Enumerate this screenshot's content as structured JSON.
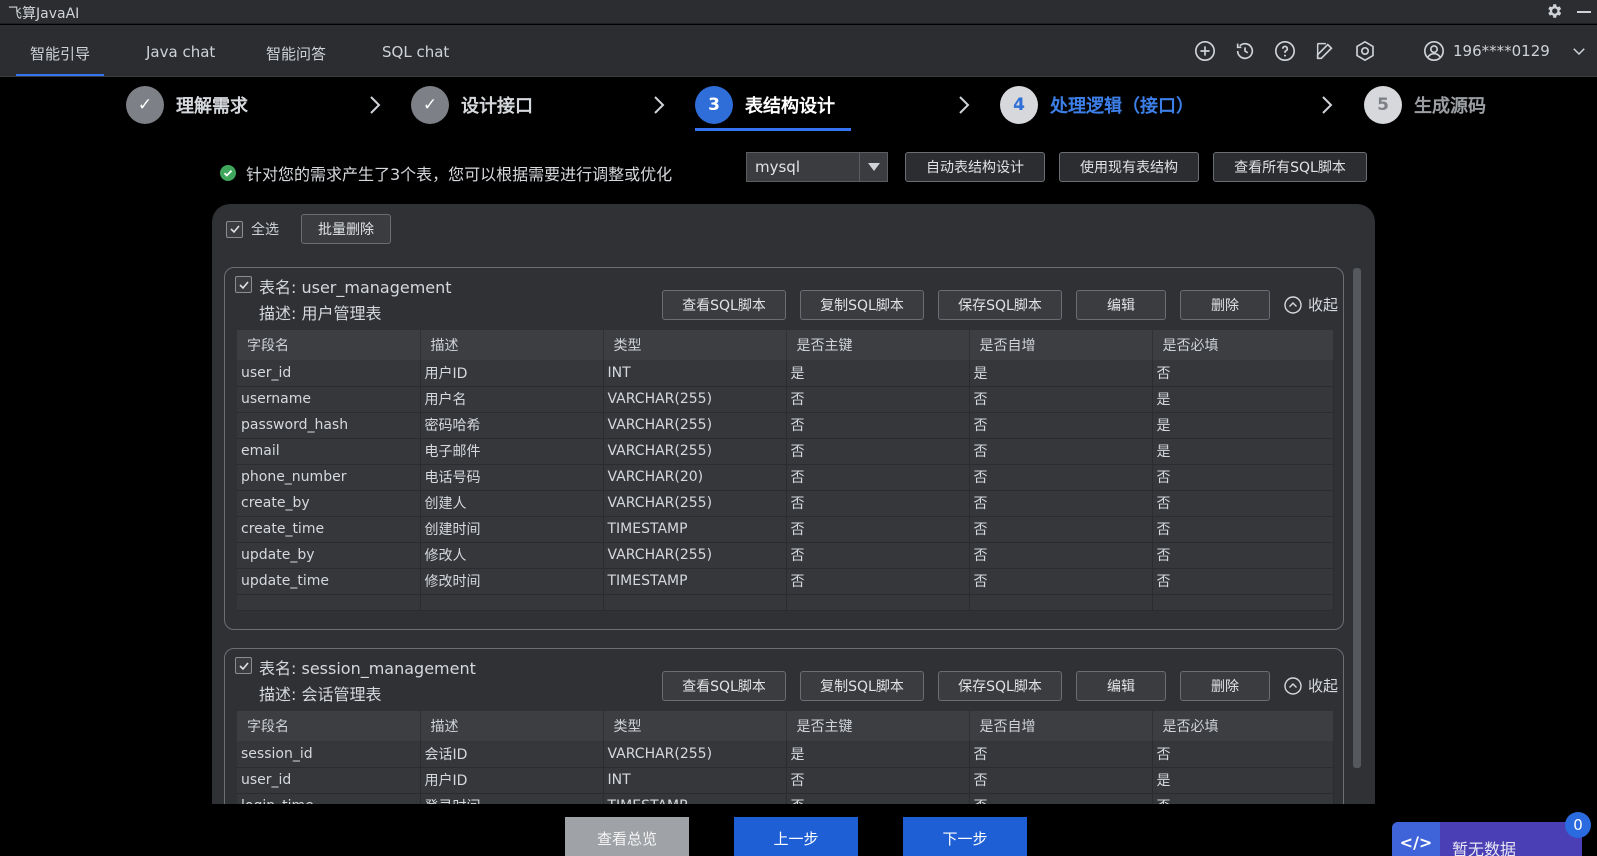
{
  "window": {
    "title": "飞算JavaAI"
  },
  "nav": {
    "tabs": [
      "智能引导",
      "Java chat",
      "智能问答",
      "SQL chat"
    ],
    "active_tab": "智能引导",
    "user": "196****0129"
  },
  "steps": [
    {
      "num": "✓",
      "label": "理解需求",
      "state": "done"
    },
    {
      "num": "✓",
      "label": "设计接口",
      "state": "done"
    },
    {
      "num": "3",
      "label": "表结构设计",
      "state": "active"
    },
    {
      "num": "4",
      "label": "处理逻辑（接口）",
      "state": "next"
    },
    {
      "num": "5",
      "label": "生成源码",
      "state": "todo"
    }
  ],
  "info": {
    "message": "针对您的需求产生了3个表，您可以根据需要进行调整或优化",
    "db_type": "mysql",
    "buttons": [
      "自动表结构设计",
      "使用现有表结构",
      "查看所有SQL脚本"
    ]
  },
  "panel": {
    "select_all": "全选",
    "batch_delete": "批量删除",
    "card_buttons": [
      "查看SQL脚本",
      "复制SQL脚本",
      "保存SQL脚本",
      "编辑",
      "删除"
    ],
    "collapse": "收起",
    "columns": [
      "字段名",
      "描述",
      "类型",
      "是否主键",
      "是否自增",
      "是否必填"
    ],
    "tables": [
      {
        "name": "表名: user_management",
        "desc": "描述: 用户管理表",
        "rows": [
          [
            "user_id",
            "用户ID",
            "INT",
            "是",
            "是",
            "否"
          ],
          [
            "username",
            "用户名",
            "VARCHAR(255)",
            "否",
            "否",
            "是"
          ],
          [
            "password_hash",
            "密码哈希",
            "VARCHAR(255)",
            "否",
            "否",
            "是"
          ],
          [
            "email",
            "电子邮件",
            "VARCHAR(255)",
            "否",
            "否",
            "是"
          ],
          [
            "phone_number",
            "电话号码",
            "VARCHAR(20)",
            "否",
            "否",
            "否"
          ],
          [
            "create_by",
            "创建人",
            "VARCHAR(255)",
            "否",
            "否",
            "否"
          ],
          [
            "create_time",
            "创建时间",
            "TIMESTAMP",
            "否",
            "否",
            "否"
          ],
          [
            "update_by",
            "修改人",
            "VARCHAR(255)",
            "否",
            "否",
            "否"
          ],
          [
            "update_time",
            "修改时间",
            "TIMESTAMP",
            "否",
            "否",
            "否"
          ]
        ]
      },
      {
        "name": "表名: session_management",
        "desc": "描述: 会话管理表",
        "rows": [
          [
            "session_id",
            "会话ID",
            "VARCHAR(255)",
            "是",
            "否",
            "否"
          ],
          [
            "user_id",
            "用户ID",
            "INT",
            "否",
            "否",
            "是"
          ],
          [
            "login_time",
            "登录时间",
            "TIMESTAMP",
            "否",
            "否",
            "否"
          ]
        ]
      }
    ]
  },
  "bottom": {
    "overview": "查看总览",
    "prev": "上一步",
    "next": "下一步"
  },
  "floating": {
    "text": "暂无数据",
    "badge": "0",
    "icon": "</>"
  }
}
